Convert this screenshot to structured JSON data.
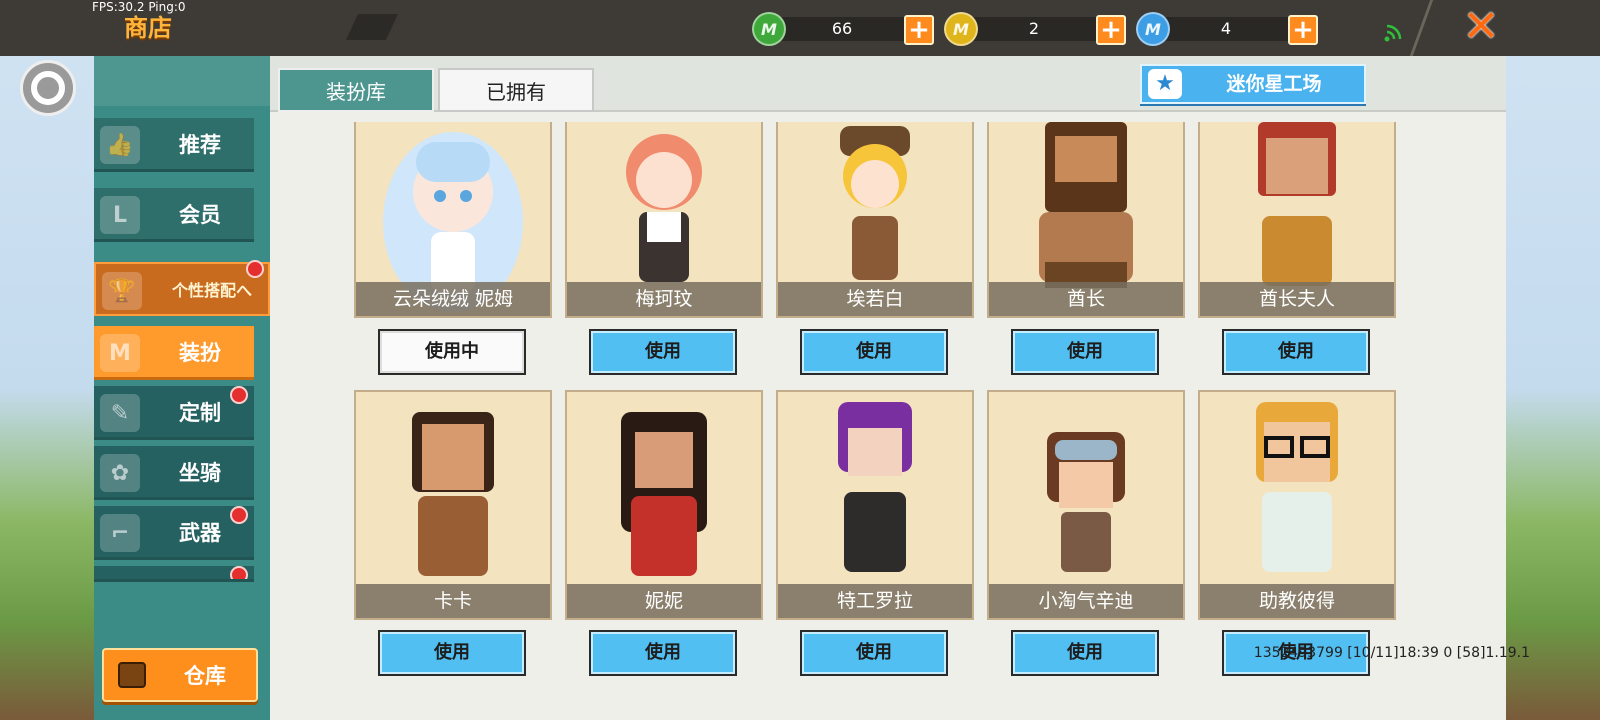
{
  "status": {
    "fps": "FPS:30.2  Ping:0"
  },
  "header": {
    "title": "商店"
  },
  "currencies": [
    {
      "icon": "green-gem-icon",
      "glyph": "M",
      "color": "#3fa83a",
      "value": "66"
    },
    {
      "icon": "gold-coin-icon",
      "glyph": "M",
      "color": "#e0b51c",
      "value": "2"
    },
    {
      "icon": "blue-star-coin-icon",
      "glyph": "M",
      "color": "#3d9ee6",
      "value": "4"
    }
  ],
  "plus_label": "+",
  "close_label": "✕",
  "sidebar": {
    "items": [
      {
        "label": "推荐",
        "icon": "thumbs-up-icon",
        "glyph": "👍"
      },
      {
        "label": "会员",
        "icon": "member-badge-icon",
        "glyph": "L"
      },
      {
        "label": "个性搭配へ",
        "icon": "trophy-icon",
        "glyph": "🏆"
      },
      {
        "label": "装扮",
        "icon": "shirt-icon",
        "glyph": "M"
      },
      {
        "label": "定制",
        "icon": "pencil-icon",
        "glyph": "✎"
      },
      {
        "label": "坐骑",
        "icon": "paw-icon",
        "glyph": "✿"
      },
      {
        "label": "武器",
        "icon": "gun-icon",
        "glyph": "⌐"
      }
    ],
    "warehouse_label": "仓库"
  },
  "tabs": [
    "装扮库",
    "已拥有"
  ],
  "workshop": {
    "label": "迷你星工场",
    "icon_glyph": "★"
  },
  "skins": [
    {
      "name": "云朵绒绒 妮姆",
      "button": "使用中",
      "in_use": true
    },
    {
      "name": "梅珂玟",
      "button": "使用",
      "in_use": false
    },
    {
      "name": "埃若白",
      "button": "使用",
      "in_use": false
    },
    {
      "name": "酋长",
      "button": "使用",
      "in_use": false
    },
    {
      "name": "酋长夫人",
      "button": "使用",
      "in_use": false
    },
    {
      "name": "卡卡",
      "button": "使用",
      "in_use": false
    },
    {
      "name": "妮妮",
      "button": "使用",
      "in_use": false
    },
    {
      "name": "特工罗拉",
      "button": "使用",
      "in_use": false
    },
    {
      "name": "小淘气辛迪",
      "button": "使用",
      "in_use": false
    },
    {
      "name": "助教彼得",
      "button": "使用",
      "in_use": false
    }
  ],
  "footer": {
    "info": "1352493799   [10/11]18:39 0      [58]1.19.1"
  }
}
